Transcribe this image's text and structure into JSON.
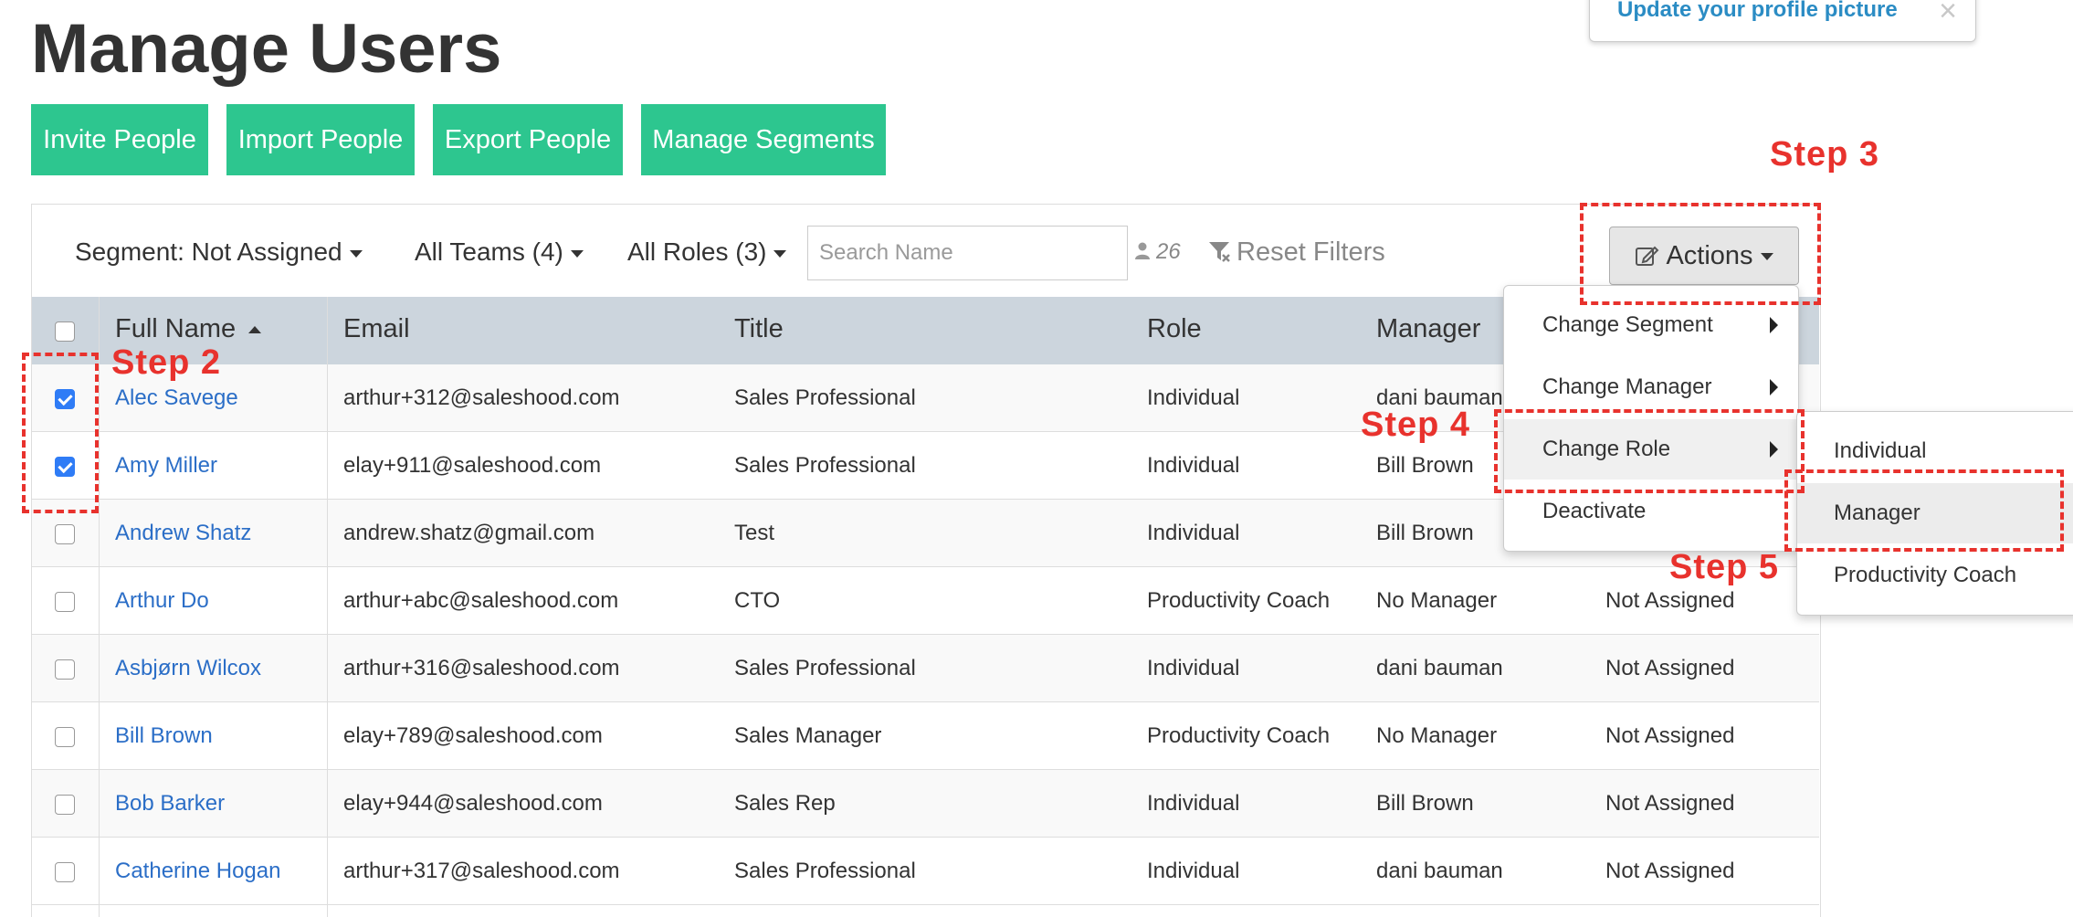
{
  "page": {
    "title": "Manage Users"
  },
  "notification": {
    "text": "Update your profile picture",
    "close": "×"
  },
  "toolbar": {
    "invite": "Invite People",
    "import": "Import People",
    "export": "Export People",
    "segments": "Manage Segments"
  },
  "filters": {
    "segment": "Segment: Not Assigned",
    "teams": "All Teams (4)",
    "roles": "All Roles (3)",
    "search_placeholder": "Search Name",
    "user_count": "26",
    "reset": "Reset Filters"
  },
  "actions": {
    "label": "Actions",
    "menu": [
      "Change Segment",
      "Change Manager",
      "Change Role",
      "Deactivate"
    ],
    "role_submenu": [
      "Individual",
      "Manager",
      "Productivity Coach"
    ]
  },
  "table": {
    "headers": [
      "Full Name",
      "Email",
      "Title",
      "Role",
      "Manager"
    ],
    "rows": [
      {
        "name": "Alec Savege",
        "email": "arthur+312@saleshood.com",
        "title": "Sales Professional",
        "role": "Individual",
        "manager": "dani bauman",
        "segment": "",
        "checked": true
      },
      {
        "name": "Amy Miller",
        "email": "elay+911@saleshood.com",
        "title": "Sales Professional",
        "role": "Individual",
        "manager": "Bill Brown",
        "segment": "",
        "checked": true
      },
      {
        "name": "Andrew Shatz",
        "email": "andrew.shatz@gmail.com",
        "title": "Test",
        "role": "Individual",
        "manager": "Bill Brown",
        "segment": "",
        "checked": false
      },
      {
        "name": "Arthur Do",
        "email": "arthur+abc@saleshood.com",
        "title": "CTO",
        "role": "Productivity Coach",
        "manager": "No Manager",
        "segment": "Not Assigned",
        "checked": false
      },
      {
        "name": "Asbjørn Wilcox",
        "email": "arthur+316@saleshood.com",
        "title": "Sales Professional",
        "role": "Individual",
        "manager": "dani bauman",
        "segment": "Not Assigned",
        "checked": false
      },
      {
        "name": "Bill Brown",
        "email": "elay+789@saleshood.com",
        "title": "Sales Manager",
        "role": "Productivity Coach",
        "manager": "No Manager",
        "segment": "Not Assigned",
        "checked": false
      },
      {
        "name": "Bob Barker",
        "email": "elay+944@saleshood.com",
        "title": "Sales Rep",
        "role": "Individual",
        "manager": "Bill Brown",
        "segment": "Not Assigned",
        "checked": false
      },
      {
        "name": "Catherine Hogan",
        "email": "arthur+317@saleshood.com",
        "title": "Sales Professional",
        "role": "Individual",
        "manager": "dani bauman",
        "segment": "Not Assigned",
        "checked": false
      }
    ]
  },
  "annotations": {
    "step2": "Step 2",
    "step3": "Step 3",
    "step4": "Step 4",
    "step5": "Step 5"
  },
  "colors": {
    "primary_green": "#2dc68f",
    "link_blue": "#2b6ec7",
    "annotation_red": "#e8322d",
    "header_gray": "#ccd5dd"
  }
}
